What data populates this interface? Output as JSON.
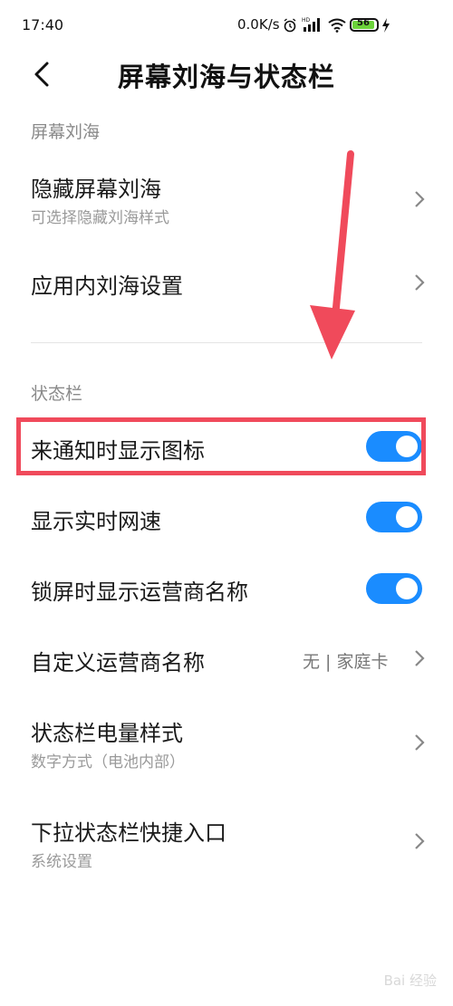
{
  "status_bar": {
    "time": "17:40",
    "net_speed": "0.0K/s",
    "battery": "56",
    "icons": [
      "alarm-icon",
      "hd-signal-icon",
      "wifi-icon",
      "battery-icon",
      "charging-icon"
    ]
  },
  "header": {
    "title": "屏幕刘海与状态栏"
  },
  "section_notch": {
    "label": "屏幕刘海",
    "items": [
      {
        "title": "隐藏屏幕刘海",
        "subtitle": "可选择隐藏刘海样式"
      },
      {
        "title": "应用内刘海设置"
      }
    ]
  },
  "section_status": {
    "label": "状态栏",
    "items": [
      {
        "title": "来通知时显示图标",
        "toggle": true
      },
      {
        "title": "显示实时网速",
        "toggle": true
      },
      {
        "title": "锁屏时显示运营商名称",
        "toggle": true
      },
      {
        "title": "自定义运营商名称",
        "value": "无 | 家庭卡"
      },
      {
        "title": "状态栏电量样式",
        "subtitle": "数字方式（电池内部）"
      },
      {
        "title": "下拉状态栏快捷入口",
        "subtitle": "系统设置"
      }
    ]
  },
  "colors": {
    "accent": "#1a8cff",
    "highlight": "#f04a5b",
    "arrow": "#f04a5b"
  },
  "watermark": "Bai 经验"
}
